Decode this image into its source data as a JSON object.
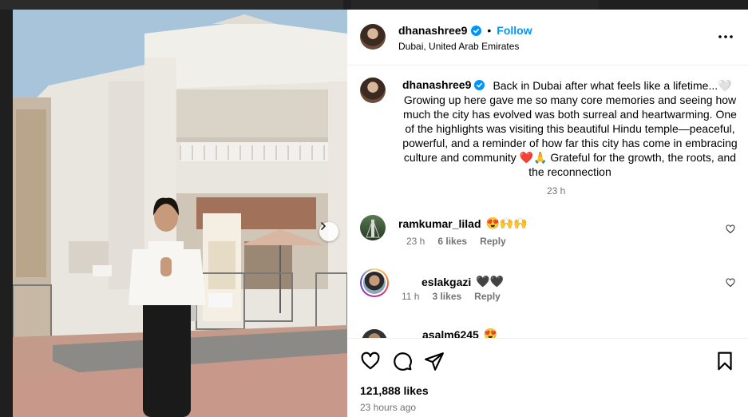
{
  "post": {
    "username": "dhanashree9",
    "follow_label": "Follow",
    "dot": "•",
    "location": "Dubai, United Arab Emirates",
    "caption": "Back in Dubai after what feels like a lifetime...🤍 Growing up here gave me so many core memories and seeing how much the city has evolved was both surreal and heartwarming. One of the highlights was visiting this beautiful Hindu temple—peaceful, powerful, and a reminder of how far this city has come in embracing culture and community ❤️🙏 Grateful for the growth, the roots, and the reconnection",
    "caption_time": "23 h",
    "likes": "121,888 likes",
    "time_ago": "23 hours ago"
  },
  "comments": [
    {
      "username": "ramkumar_lilad",
      "text": "😍🙌🙌",
      "time": "23 h",
      "likes": "6 likes",
      "reply": "Reply"
    },
    {
      "username": "eslakgazi",
      "text": "🖤🖤",
      "time": "11 h",
      "likes": "3 likes",
      "reply": "Reply"
    },
    {
      "username": "asalm6245",
      "text": "😍",
      "time": "",
      "likes": "",
      "reply": ""
    }
  ],
  "icons": {
    "header_more": "more-horizontal-icon",
    "verified": "verified-badge-icon",
    "like": "heart-icon",
    "comment": "comment-icon",
    "share": "send-icon",
    "save": "bookmark-icon",
    "next": "chevron-right-icon"
  },
  "colors": {
    "accent": "#0095f6",
    "muted": "#737373"
  }
}
